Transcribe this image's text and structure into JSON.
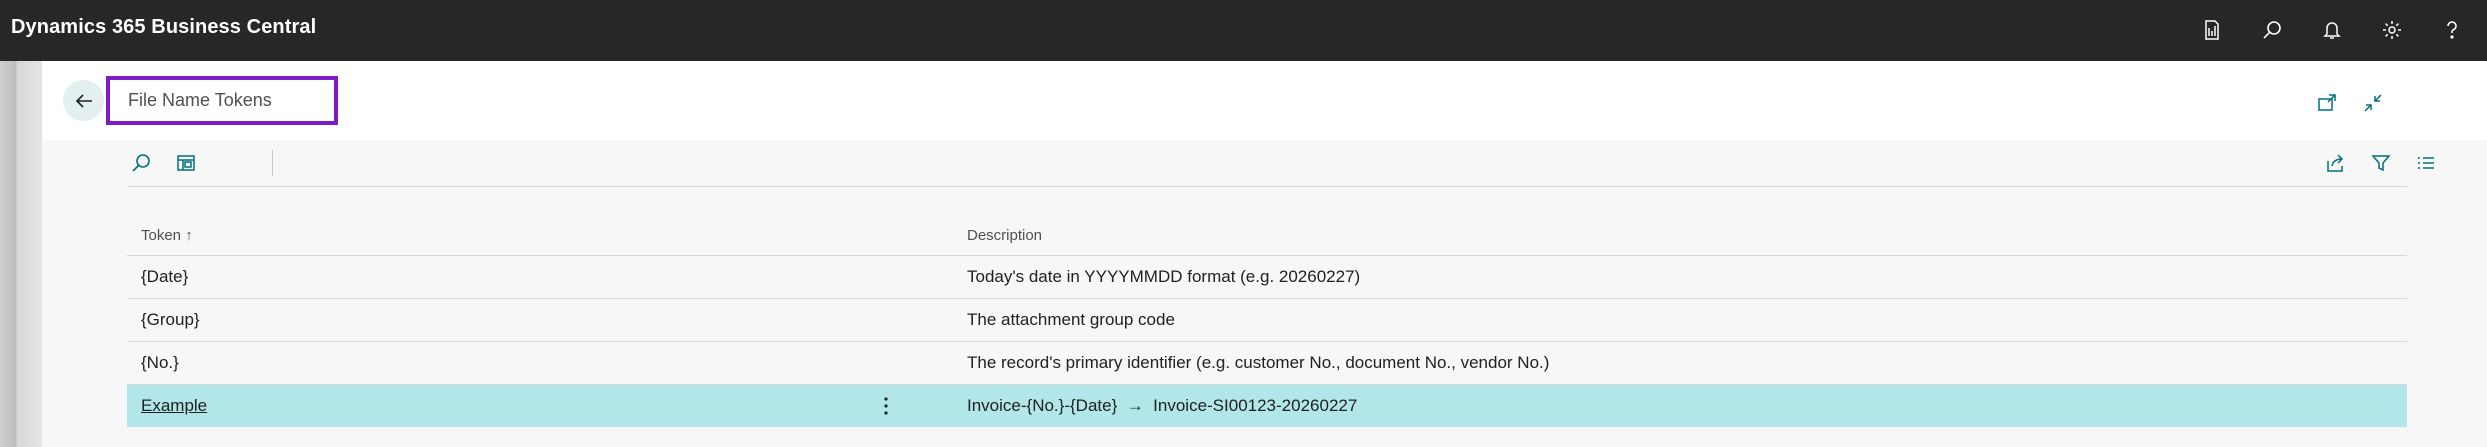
{
  "app": {
    "title": "Dynamics 365 Business Central"
  },
  "topbar_icons": [
    "report-icon",
    "search-icon",
    "bell-icon",
    "gear-icon",
    "help-icon"
  ],
  "page": {
    "title": "File Name Tokens"
  },
  "header_actions": [
    "open-new-window-icon",
    "collapse-icon"
  ],
  "toolbar": {
    "left": [
      "search-icon",
      "layout-icon"
    ],
    "right": [
      "share-icon",
      "filter-icon",
      "list-view-icon"
    ]
  },
  "table": {
    "columns": [
      {
        "label": "Token",
        "sort_indicator": "↑"
      },
      {
        "label": "Description"
      }
    ],
    "rows": [
      {
        "token": "{Date}",
        "description": "Today's date in YYYYMMDD format (e.g. 20260227)"
      },
      {
        "token": "{Group}",
        "description": "The attachment group code"
      },
      {
        "token": "{No.}",
        "description": "The record's primary identifier (e.g. customer No., document No., vendor No.)"
      },
      {
        "token": "Example",
        "description": "Invoice-{No.}-{Date}  →  Invoice-SI00123-20260227",
        "selected": true
      }
    ]
  },
  "colors": {
    "topbar": "#272727",
    "accent": "#00707a",
    "selected_row": "#b2e7ea",
    "title_highlight": "#7d1bc4"
  }
}
